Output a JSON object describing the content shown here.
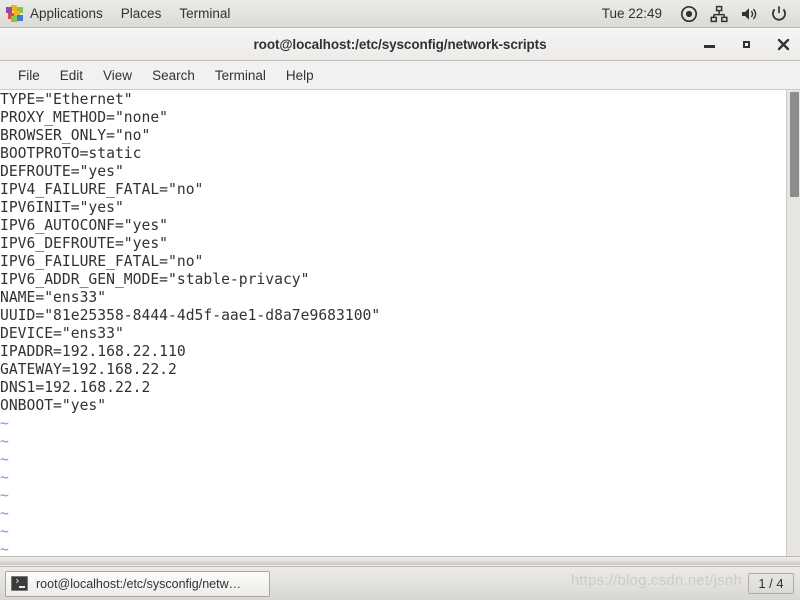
{
  "panel": {
    "applications_label": "Applications",
    "places_label": "Places",
    "terminal_label": "Terminal",
    "clock": "Tue 22:49",
    "icons": [
      "applications-pinwheel-icon",
      "location-icon",
      "network-icon",
      "volume-icon",
      "power-icon"
    ]
  },
  "window": {
    "title": "root@localhost:/etc/sysconfig/network-scripts",
    "controls": {
      "minimize": "minimize-button",
      "maximize": "maximize-button",
      "close": "close-button"
    }
  },
  "menubar": {
    "items": [
      {
        "label": "File"
      },
      {
        "label": "Edit"
      },
      {
        "label": "View"
      },
      {
        "label": "Search"
      },
      {
        "label": "Terminal"
      },
      {
        "label": "Help"
      }
    ]
  },
  "terminal": {
    "lines": [
      "TYPE=\"Ethernet\"",
      "PROXY_METHOD=\"none\"",
      "BROWSER_ONLY=\"no\"",
      "BOOTPROTO=static",
      "DEFROUTE=\"yes\"",
      "IPV4_FAILURE_FATAL=\"no\"",
      "IPV6INIT=\"yes\"",
      "IPV6_AUTOCONF=\"yes\"",
      "IPV6_DEFROUTE=\"yes\"",
      "IPV6_FAILURE_FATAL=\"no\"",
      "IPV6_ADDR_GEN_MODE=\"stable-privacy\"",
      "NAME=\"ens33\"",
      "UUID=\"81e25358-8444-4d5f-aae1-d8a7e9683100\"",
      "DEVICE=\"ens33\"",
      "IPADDR=192.168.22.110",
      "GATEWAY=192.168.22.2",
      "DNS1=192.168.22.2",
      "ONBOOT=\"yes\""
    ],
    "empty_markers": [
      "~",
      "~",
      "~",
      "~",
      "~",
      "~",
      "~",
      "~"
    ],
    "colors": {
      "background": "#ffffff",
      "foreground": "#2e3436",
      "nontext": "#6f9ee8"
    }
  },
  "taskbar": {
    "task_label": "root@localhost:/etc/sysconfig/netw…",
    "task_icon": "terminal-icon",
    "watermark": "https://blog.csdn.net/jsnh",
    "workspace": "1 / 4"
  }
}
